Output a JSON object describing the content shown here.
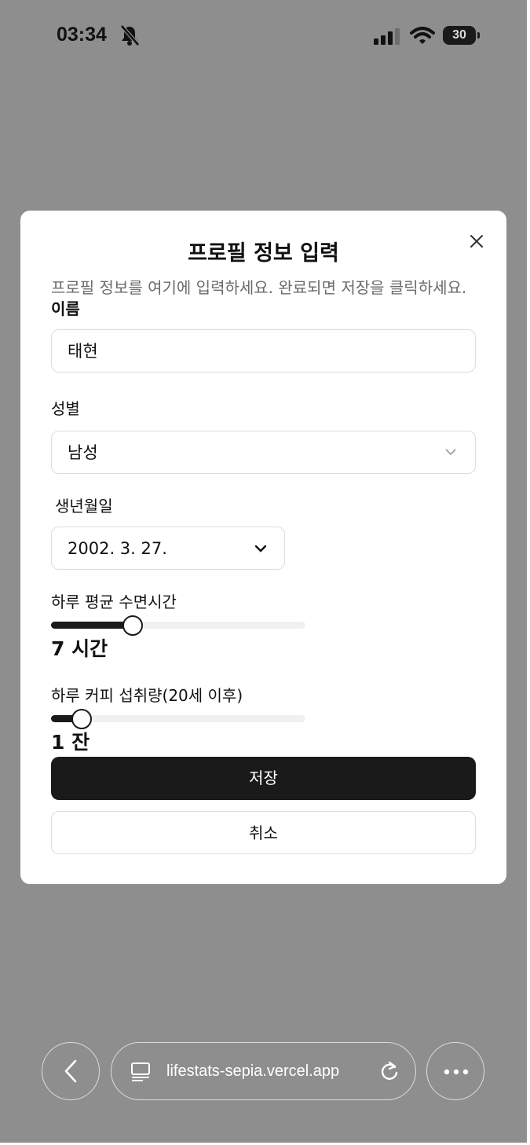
{
  "status_bar": {
    "time": "03:34",
    "battery": "30"
  },
  "dialog": {
    "title": "프로필 정보 입력",
    "description": "프로필 정보를 여기에 입력하세요. 완료되면 저장을 클릭하세요.",
    "name_label": "이름",
    "name_value": "태현",
    "gender_label": "성별",
    "gender_value": "남성",
    "birth_label": "생년월일",
    "birth_value": "2002. 3. 27.",
    "sleep_label": "하루 평균 수면시간",
    "sleep_value_text": "7 시간",
    "sleep_level": 0.32,
    "coffee_label": "하루 커피 섭취량(20세 이후)",
    "coffee_value_text": "1 잔",
    "coffee_level": 0.12,
    "save_label": "저장",
    "cancel_label": "취소"
  },
  "browser": {
    "url": "lifestats-sepia.vercel.app"
  },
  "icons": [
    "bell-slash-icon",
    "signal-icon",
    "wifi-icon",
    "battery-icon",
    "close-icon",
    "chevron-down-icon",
    "back-icon",
    "tabs-icon",
    "reload-icon",
    "more-icon"
  ]
}
